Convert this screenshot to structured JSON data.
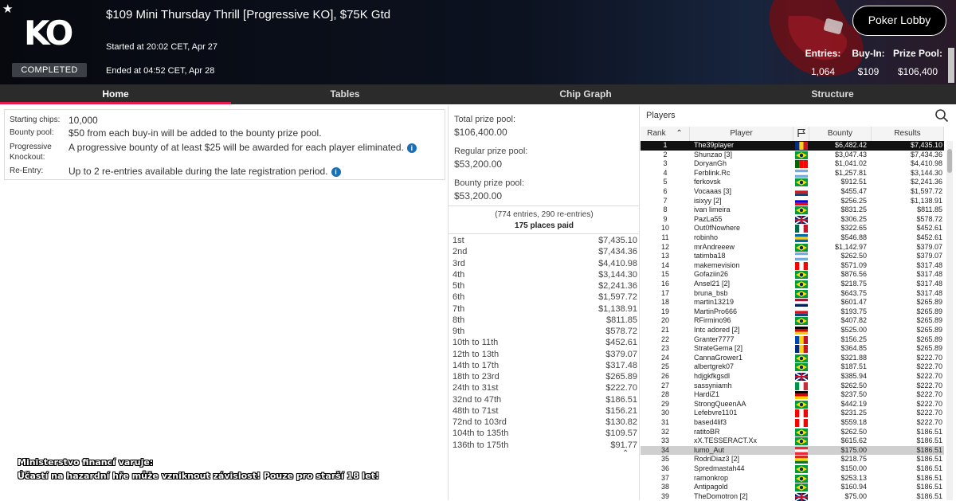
{
  "header": {
    "title": "$109 Mini Thursday Thrill [Progressive KO], $75K Gtd",
    "logo_text": "KO",
    "status": "COMPLETED",
    "started": "Started at 20:02 CET, Apr 27",
    "ended": "Ended at 04:52 CET, Apr 28",
    "lobby_button": "Poker Lobby",
    "stats": [
      {
        "label": "Entries:",
        "value": "1,064"
      },
      {
        "label": "Buy-In:",
        "value": "$109"
      },
      {
        "label": "Prize Pool:",
        "value": "$106,400"
      }
    ]
  },
  "tabs": [
    {
      "label": "Home",
      "active": true
    },
    {
      "label": "Tables",
      "active": false
    },
    {
      "label": "Chip Graph",
      "active": false
    },
    {
      "label": "Structure",
      "active": false
    }
  ],
  "info": [
    {
      "key": "Starting chips:",
      "value": "10,000"
    },
    {
      "key": "Bounty pool:",
      "value": "$50 from each buy-in will be added to the bounty prize pool."
    },
    {
      "key": "Progressive Knockout:",
      "value": "A progressive bounty of at least $25 will be awarded for each player eliminated."
    },
    {
      "key": "Re-Entry:",
      "value": "Up to 2 re-entries available during the late registration period."
    }
  ],
  "prize_pools": [
    {
      "label": "Total prize pool:",
      "value": "$106,400.00"
    },
    {
      "label": "Regular prize pool:",
      "value": "$53,200.00"
    },
    {
      "label": "Bounty prize pool:",
      "value": "$53,200.00"
    }
  ],
  "entries_note": "(774 entries, 290 re-entries)",
  "places_paid": "175 places paid",
  "payouts": [
    {
      "place": "1st",
      "amount": "$7,435.10"
    },
    {
      "place": "2nd",
      "amount": "$7,434.36"
    },
    {
      "place": "3rd",
      "amount": "$4,410.98"
    },
    {
      "place": "4th",
      "amount": "$3,144.30"
    },
    {
      "place": "5th",
      "amount": "$2,241.36"
    },
    {
      "place": "6th",
      "amount": "$1,597.72"
    },
    {
      "place": "7th",
      "amount": "$1,138.91"
    },
    {
      "place": "8th",
      "amount": "$811.85"
    },
    {
      "place": "9th",
      "amount": "$578.72"
    },
    {
      "place": "10th to 11th",
      "amount": "$452.61"
    },
    {
      "place": "12th to 13th",
      "amount": "$379.07"
    },
    {
      "place": "14th to 17th",
      "amount": "$317.48"
    },
    {
      "place": "18th to 23rd",
      "amount": "$265.89"
    },
    {
      "place": "24th to 31st",
      "amount": "$222.70"
    },
    {
      "place": "32nd to 47th",
      "amount": "$186.51"
    },
    {
      "place": "48th to 71st",
      "amount": "$156.21"
    },
    {
      "place": "72nd to 103rd",
      "amount": "$130.82"
    },
    {
      "place": "104th to 135th",
      "amount": "$109.57"
    },
    {
      "place": "136th to 175th",
      "amount": "$91.77"
    }
  ],
  "players_panel": {
    "title": "Players",
    "columns": {
      "rank": "Rank",
      "player": "Player",
      "bounty": "Bounty",
      "results": "Results"
    }
  },
  "flag_colors": {
    "ro": [
      "#002b7f",
      "#fcd116",
      "#ce1126"
    ],
    "br": [
      "#009c3b",
      "#ffdf00",
      "#002776"
    ],
    "pt": [
      "#006600",
      "#ff0000",
      "#ff0000"
    ],
    "ar": [
      "#74acdf",
      "#ffffff",
      "#74acdf"
    ],
    "cz": [
      "#ffffff",
      "#d7141a",
      "#11457e"
    ],
    "si": [
      "#ffffff",
      "#0000ff",
      "#ff0000"
    ],
    "gb": [
      "#012169",
      "#ffffff",
      "#c8102e"
    ],
    "mx": [
      "#006847",
      "#ffffff",
      "#ce1126"
    ],
    "se": [
      "#006aa7",
      "#fecc00",
      "#006aa7"
    ],
    "ca": [
      "#ff0000",
      "#ffffff",
      "#ff0000"
    ],
    "no": [
      "#ba0c2f",
      "#ffffff",
      "#00205b"
    ],
    "de": [
      "#000000",
      "#dd0000",
      "#ffce00"
    ],
    "md": [
      "#0046ae",
      "#ffd200",
      "#cc092f"
    ],
    "it": [
      "#009246",
      "#ffffff",
      "#ce2b37"
    ],
    "ge": [
      "#ffffff",
      "#ff0000",
      "#ffffff"
    ],
    "bo": [
      "#d52b1e",
      "#f9e300",
      "#007934"
    ],
    "at": [
      "#ed2939",
      "#ffffff",
      "#ed2939"
    ]
  },
  "players": [
    {
      "rank": "1",
      "name": "The39player",
      "flag": "ro",
      "bounty": "$6,482.42",
      "result": "$7,435.10",
      "hl": "black"
    },
    {
      "rank": "2",
      "name": "Shunzao [3]",
      "flag": "br",
      "bounty": "$3,047.43",
      "result": "$7,434.36"
    },
    {
      "rank": "3",
      "name": "DoryanGh",
      "flag": "pt",
      "bounty": "$1,041.02",
      "result": "$4,410.98"
    },
    {
      "rank": "4",
      "name": "Ferblink.Rc",
      "flag": "ar",
      "bounty": "$1,257.81",
      "result": "$3,144.30"
    },
    {
      "rank": "5",
      "name": "ferkovsk",
      "flag": "br",
      "bounty": "$912.51",
      "result": "$2,241.36"
    },
    {
      "rank": "6",
      "name": "Vocaaas [3]",
      "flag": "cz",
      "bounty": "$455.47",
      "result": "$1,597.72"
    },
    {
      "rank": "7",
      "name": "isixyy [2]",
      "flag": "si",
      "bounty": "$256.25",
      "result": "$1,138.91"
    },
    {
      "rank": "8",
      "name": "ivan limeira",
      "flag": "br",
      "bounty": "$831.25",
      "result": "$811.85"
    },
    {
      "rank": "9",
      "name": "PazLa55",
      "flag": "gb",
      "bounty": "$306.25",
      "result": "$578.72"
    },
    {
      "rank": "10",
      "name": "Out0fNowhere",
      "flag": "mx",
      "bounty": "$322.65",
      "result": "$452.61"
    },
    {
      "rank": "11",
      "name": "robinho",
      "flag": "se",
      "bounty": "$546.88",
      "result": "$452.61"
    },
    {
      "rank": "12",
      "name": "mrAndreeew",
      "flag": "br",
      "bounty": "$1,142.97",
      "result": "$379.07"
    },
    {
      "rank": "13",
      "name": "tatimba18",
      "flag": "ar",
      "bounty": "$262.50",
      "result": "$379.07"
    },
    {
      "rank": "14",
      "name": "makemevision",
      "flag": "ca",
      "bounty": "$571.09",
      "result": "$317.48"
    },
    {
      "rank": "15",
      "name": "Gofaziin26",
      "flag": "br",
      "bounty": "$876.56",
      "result": "$317.48"
    },
    {
      "rank": "16",
      "name": "Ansel21 [2]",
      "flag": "br",
      "bounty": "$218.75",
      "result": "$317.48"
    },
    {
      "rank": "17",
      "name": "bruna_bsb",
      "flag": "br",
      "bounty": "$643.75",
      "result": "$317.48"
    },
    {
      "rank": "18",
      "name": "martin13219",
      "flag": "no",
      "bounty": "$601.47",
      "result": "$265.89"
    },
    {
      "rank": "19",
      "name": "MartinPro666",
      "flag": "cz",
      "bounty": "$193.75",
      "result": "$265.89"
    },
    {
      "rank": "20",
      "name": "RFirmino96",
      "flag": "br",
      "bounty": "$407.82",
      "result": "$265.89"
    },
    {
      "rank": "21",
      "name": "Intc adored [2]",
      "flag": "de",
      "bounty": "$525.00",
      "result": "$265.89"
    },
    {
      "rank": "22",
      "name": "Granter7777",
      "flag": "md",
      "bounty": "$156.25",
      "result": "$265.89"
    },
    {
      "rank": "23",
      "name": "StrateGema [2]",
      "flag": "ro",
      "bounty": "$364.85",
      "result": "$265.89"
    },
    {
      "rank": "24",
      "name": "CannaGrower1",
      "flag": "br",
      "bounty": "$321.88",
      "result": "$222.70"
    },
    {
      "rank": "25",
      "name": "albertgrek07",
      "flag": "br",
      "bounty": "$187.51",
      "result": "$222.70"
    },
    {
      "rank": "26",
      "name": "hdjgkfkgsdl",
      "flag": "gb",
      "bounty": "$385.94",
      "result": "$222.70"
    },
    {
      "rank": "27",
      "name": "sassyniamh",
      "flag": "it",
      "bounty": "$262.50",
      "result": "$222.70"
    },
    {
      "rank": "28",
      "name": "HardiZ1",
      "flag": "de",
      "bounty": "$237.50",
      "result": "$222.70"
    },
    {
      "rank": "29",
      "name": "StrongQueenAA",
      "flag": "br",
      "bounty": "$442.19",
      "result": "$222.70"
    },
    {
      "rank": "30",
      "name": "Lefebvre1101",
      "flag": "ca",
      "bounty": "$231.25",
      "result": "$222.70"
    },
    {
      "rank": "31",
      "name": "based4lif3",
      "flag": "ca",
      "bounty": "$559.18",
      "result": "$222.70"
    },
    {
      "rank": "32",
      "name": "ratitoBR",
      "flag": "br",
      "bounty": "$262.50",
      "result": "$186.51"
    },
    {
      "rank": "33",
      "name": "xX.TESSERACT.Xx",
      "flag": "br",
      "bounty": "$615.62",
      "result": "$186.51"
    },
    {
      "rank": "34",
      "name": "lumo_Aut",
      "flag": "at",
      "bounty": "$175.00",
      "result": "$186.51",
      "hl": "grey"
    },
    {
      "rank": "35",
      "name": "RodriDiaz3 [2]",
      "flag": "bo",
      "bounty": "$218.75",
      "result": "$186.51"
    },
    {
      "rank": "36",
      "name": "Spredmastah44",
      "flag": "br",
      "bounty": "$150.00",
      "result": "$186.51"
    },
    {
      "rank": "37",
      "name": "ramonkrop",
      "flag": "br",
      "bounty": "$253.13",
      "result": "$186.51"
    },
    {
      "rank": "38",
      "name": "Antipagold",
      "flag": "br",
      "bounty": "$160.94",
      "result": "$186.51"
    },
    {
      "rank": "39",
      "name": "TheDomotron [2]",
      "flag": "gb",
      "bounty": "$75.00",
      "result": "$186.51"
    }
  ],
  "warning": {
    "line1": "Ministerstvo financí varuje:",
    "line2": "Účastí na hazardní hře může vzniknout závislost! Pouze pro starší 18 let!"
  }
}
